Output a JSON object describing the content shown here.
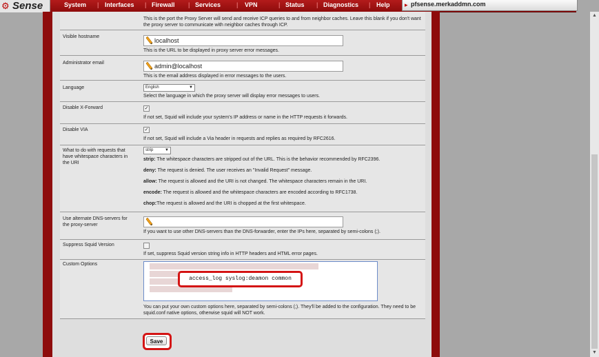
{
  "nav": {
    "logo_text": "Sense",
    "menu": [
      "System",
      "Interfaces",
      "Firewall",
      "Services",
      "VPN",
      "Status",
      "Diagnostics",
      "Help"
    ],
    "hostname": "pfsense.merkaddmn.com"
  },
  "rows": {
    "icp": {
      "desc": "This is the port the Proxy Server will send and receive ICP queries to and from neighbor caches. Leave this blank if you don't want the proxy server to communicate with neighbor caches through ICP."
    },
    "visible_hostname": {
      "label": "Visible hostname",
      "value": "localhost",
      "desc": "This is the URL to be displayed in proxy server error messages."
    },
    "admin_email": {
      "label": "Administrator email",
      "value": "admin@localhost",
      "desc": "This is the email address displayed in error messages to the users."
    },
    "language": {
      "label": "Language",
      "value": "English",
      "desc": "Select the language in which the proxy server will display error messages to users."
    },
    "disable_xforward": {
      "label": "Disable X-Forward",
      "checked": true,
      "desc": "If not set, Squid will include your system's IP address or name in the HTTP requests it forwards."
    },
    "disable_via": {
      "label": "Disable VIA",
      "checked": true,
      "desc": "If not set, Squid will include a Via header in requests and replies as required by RFC2616."
    },
    "whitespace": {
      "label": "What to do with requests that have whitespace characters in the URI",
      "value": "strip",
      "options": [
        {
          "name": "strip:",
          "text": " The whitespace characters are stripped out of the URL. This is the behavior recommended by RFC2396."
        },
        {
          "name": "deny:",
          "text": " The request is denied. The user receives an \"Invalid Request\" message."
        },
        {
          "name": "allow:",
          "text": " The request is allowed and the URI is not changed. The whitespace characters remain in the URI."
        },
        {
          "name": "encode:",
          "text": " The request is allowed and the whitespace characters are encoded according to RFC1738."
        },
        {
          "name": "chop:",
          "text": "The request is allowed and the URI is chopped at the first whitespace."
        }
      ]
    },
    "dns_servers": {
      "label": "Use alternate DNS-servers for the proxy-server",
      "value": "",
      "desc": "If you want to use other DNS-servers than the DNS-forwarder, enter the IPs here, separated by semi-colons (;)."
    },
    "suppress_version": {
      "label": "Suppress Squid Version",
      "checked": false,
      "desc": "If set, suppress Squid version string info in HTTP headers and HTML error pages."
    },
    "custom_options": {
      "label": "Custom Options",
      "highlighted_line": "access_log syslog:deamon common",
      "desc": "You can put your own custom options here, separated by semi-colons (;). They'll be added to the configuration. They need to be squid.conf native options, otherwise squid will NOT work."
    }
  },
  "save_label": "Save",
  "colors": {
    "nav_red": "#a51515",
    "highlight_red": "#d41414"
  }
}
